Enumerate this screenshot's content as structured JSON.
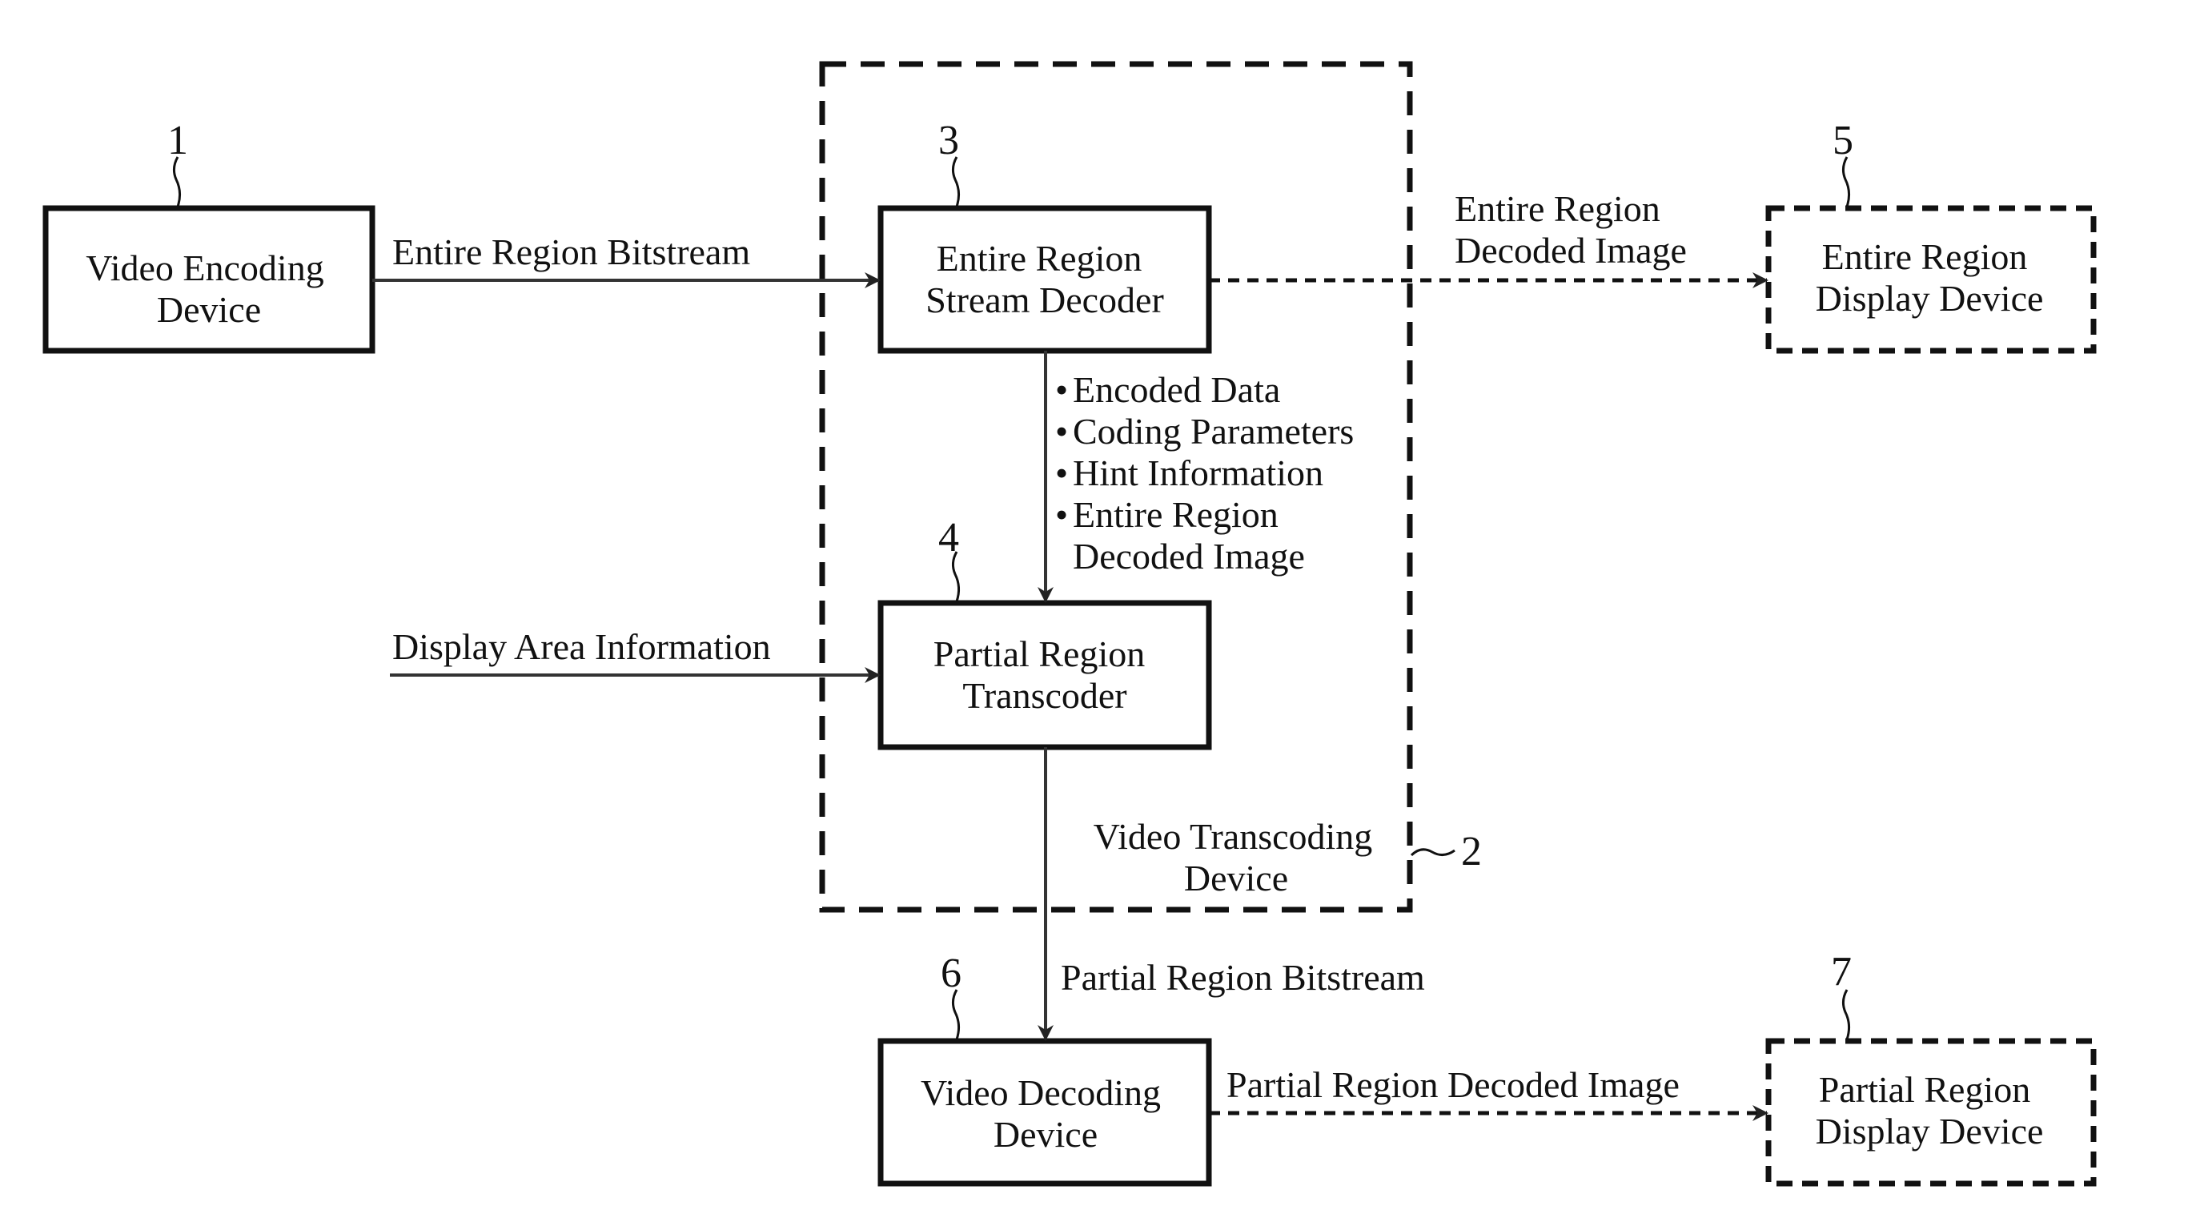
{
  "diagram": {
    "nodes": {
      "video_encoding_device": {
        "ref": "1",
        "line1": "Video Encoding",
        "line2": "Device",
        "style": "solid"
      },
      "video_transcoding_device": {
        "ref": "2",
        "line1": "Video Transcoding",
        "line2": "Device",
        "style": "dashed"
      },
      "entire_region_stream_decoder": {
        "ref": "3",
        "line1": "Entire Region",
        "line2": "Stream Decoder",
        "style": "solid"
      },
      "partial_region_transcoder": {
        "ref": "4",
        "line1": "Partial Region",
        "line2": "Transcoder",
        "style": "solid"
      },
      "entire_region_display_device": {
        "ref": "5",
        "line1": "Entire Region",
        "line2": "Display Device",
        "style": "dashed"
      },
      "video_decoding_device": {
        "ref": "6",
        "line1": "Video Decoding",
        "line2": "Device",
        "style": "solid"
      },
      "partial_region_display_device": {
        "ref": "7",
        "line1": "Partial Region",
        "line2": "Display Device",
        "style": "dashed"
      }
    },
    "edges": {
      "entire_region_bitstream": {
        "label": "Entire Region Bitstream",
        "from": "1",
        "to": "3",
        "style": "solid"
      },
      "entire_region_decoded_image": {
        "line1": "Entire Region",
        "line2": "Decoded Image",
        "from": "3",
        "to": "5",
        "style": "dashed"
      },
      "decoder_to_transcoder": {
        "from": "3",
        "to": "4",
        "style": "solid",
        "items": [
          "Encoded Data",
          "Coding Parameters",
          "Hint Information",
          "Entire Region"
        ],
        "item4_cont": "Decoded Image",
        "bullet": "•"
      },
      "display_area_information": {
        "label": "Display Area Information",
        "to": "4",
        "style": "solid"
      },
      "partial_region_bitstream": {
        "label": "Partial Region Bitstream",
        "from": "4",
        "to": "6",
        "style": "solid"
      },
      "partial_region_decoded_image": {
        "label": "Partial Region Decoded Image",
        "from": "6",
        "to": "7",
        "style": "dashed"
      }
    }
  }
}
